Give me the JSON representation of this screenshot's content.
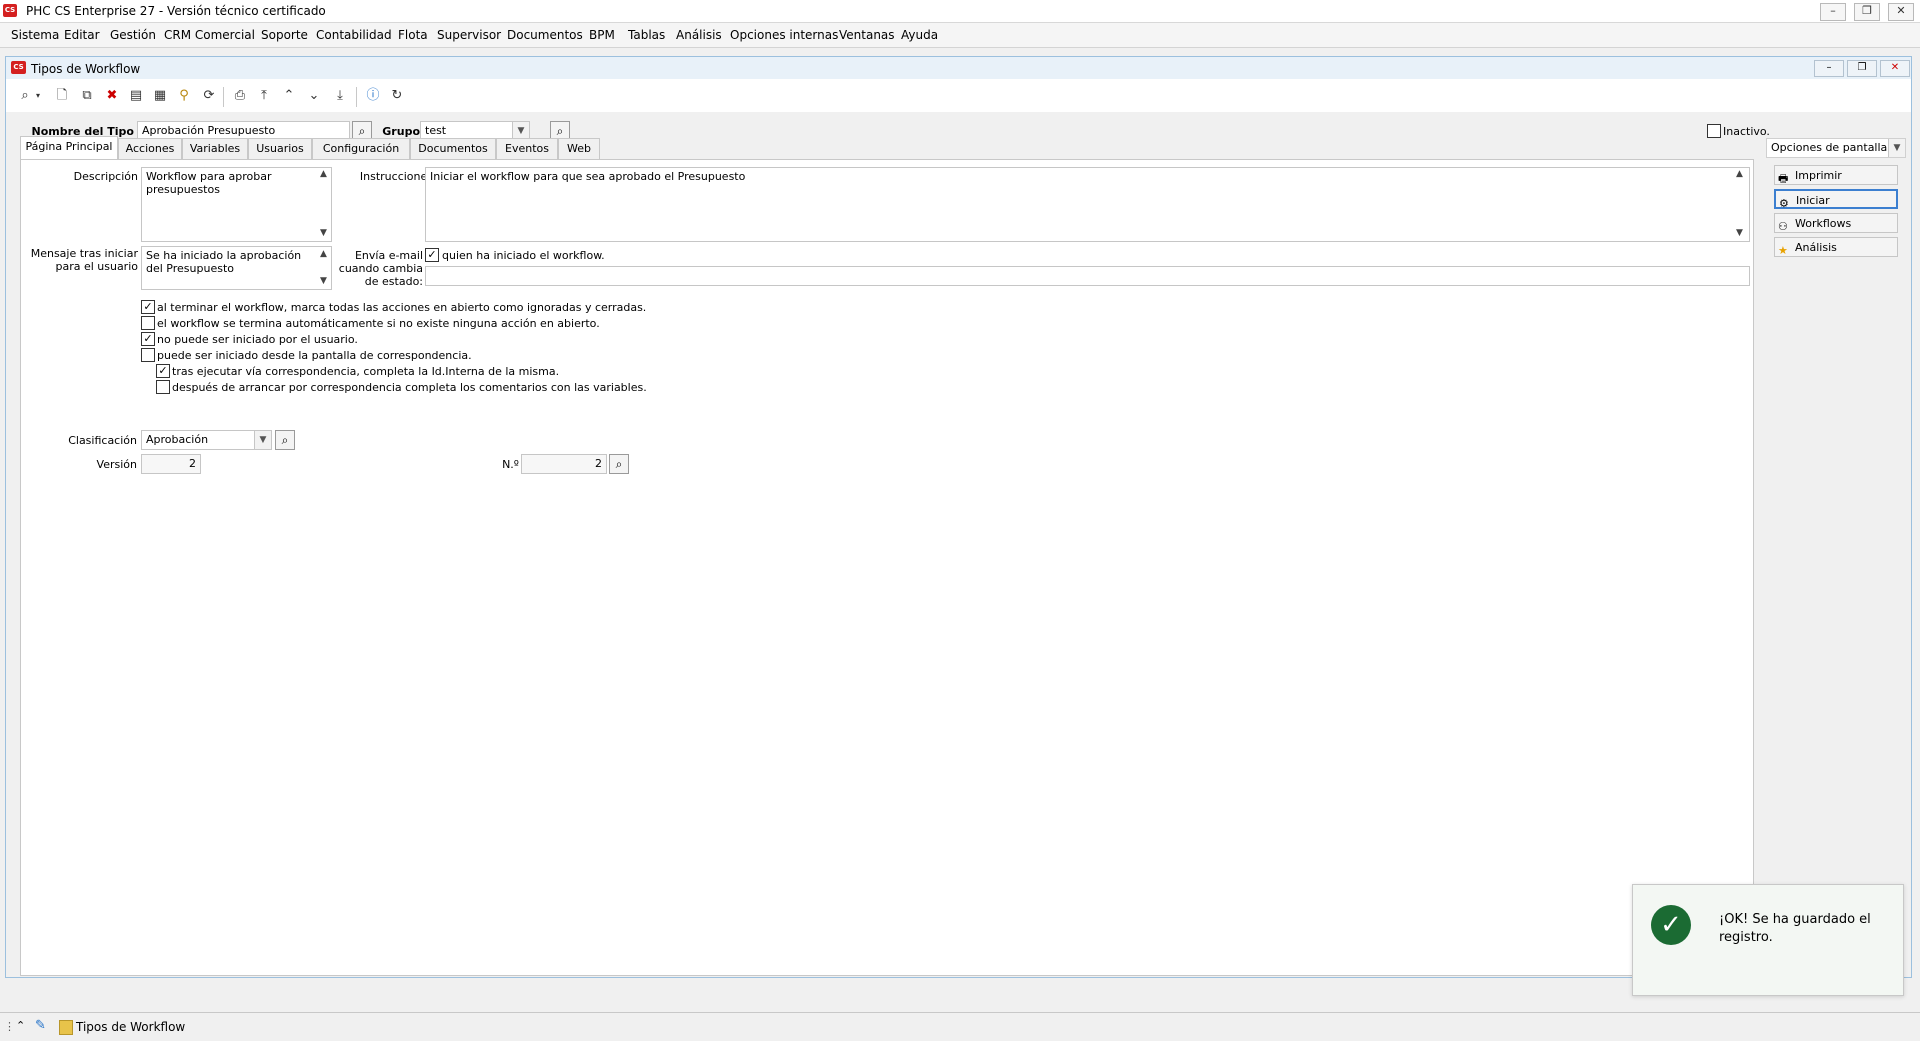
{
  "app": {
    "title": "PHC CS Enterprise 27 - Versión técnico certificado",
    "logo": "CS",
    "window_buttons": {
      "minimize": "–",
      "restore": "❐",
      "close": "✕"
    }
  },
  "menu": [
    "Sistema",
    "Editar",
    "Gestión",
    "CRM Comercial",
    "Soporte",
    "Contabilidad",
    "Flota",
    "Supervisor",
    "Documentos",
    "BPM",
    "Tablas",
    "Análisis",
    "Opciones internas",
    "Ventanas",
    "Ayuda"
  ],
  "window": {
    "title": "Tipos de Workflow",
    "icon": "CS"
  },
  "header": {
    "nombre_label": "Nombre del Tipo",
    "nombre_value": "Aprobación Presupuesto",
    "grupo_label": "Grupo",
    "grupo_value": "test",
    "inactivo_label": "Inactivo."
  },
  "tabs": [
    "Página Principal",
    "Acciones",
    "Variables",
    "Usuarios",
    "Configuración",
    "Documentos",
    "Eventos",
    "Web"
  ],
  "main": {
    "descripcion_label": "Descripción",
    "descripcion_value": "Workflow para aprobar presupuestos",
    "instrucciones_label": "Instrucciones",
    "instrucciones_value": "Iniciar el workflow para que sea aprobado el Presupuesto",
    "mensaje_label_1": "Mensaje tras iniciar",
    "mensaje_label_2": "para el usuario",
    "mensaje_value": "Se ha iniciado la aprobación del Presupuesto",
    "envia_label_1": "Envía e-mail",
    "envia_label_2": "cuando cambia",
    "envia_label_3": "de estado:",
    "envia_check_label": "quien ha iniciado el workflow.",
    "checkboxes": [
      {
        "label": "al terminar el workflow, marca todas las acciones en abierto como ignoradas y cerradas.",
        "checked": true
      },
      {
        "label": "el workflow se termina automáticamente si no existe ninguna acción en abierto.",
        "checked": false
      },
      {
        "label": "no puede ser iniciado por el usuario.",
        "checked": true
      },
      {
        "label": "puede ser iniciado desde la pantalla de correspondencia.",
        "checked": false
      },
      {
        "label": "tras ejecutar vía correspondencia, completa la Id.Interna de la misma.",
        "checked": true
      },
      {
        "label": "después de arrancar por correspondencia completa los comentarios con las variables.",
        "checked": false
      }
    ],
    "clasificacion_label": "Clasificación",
    "clasificacion_value": "Aprobación",
    "version_label": "Versión",
    "version_value": "2",
    "no_label": "N.º",
    "no_value": "2"
  },
  "side": {
    "options_label": "Opciones de pantalla",
    "buttons": [
      "Imprimir",
      "Iniciar",
      "Workflows",
      "Análisis"
    ]
  },
  "toast": {
    "message": "¡OK! Se ha guardado el registro."
  },
  "taskbar": {
    "item": "Tipos de Workflow"
  }
}
